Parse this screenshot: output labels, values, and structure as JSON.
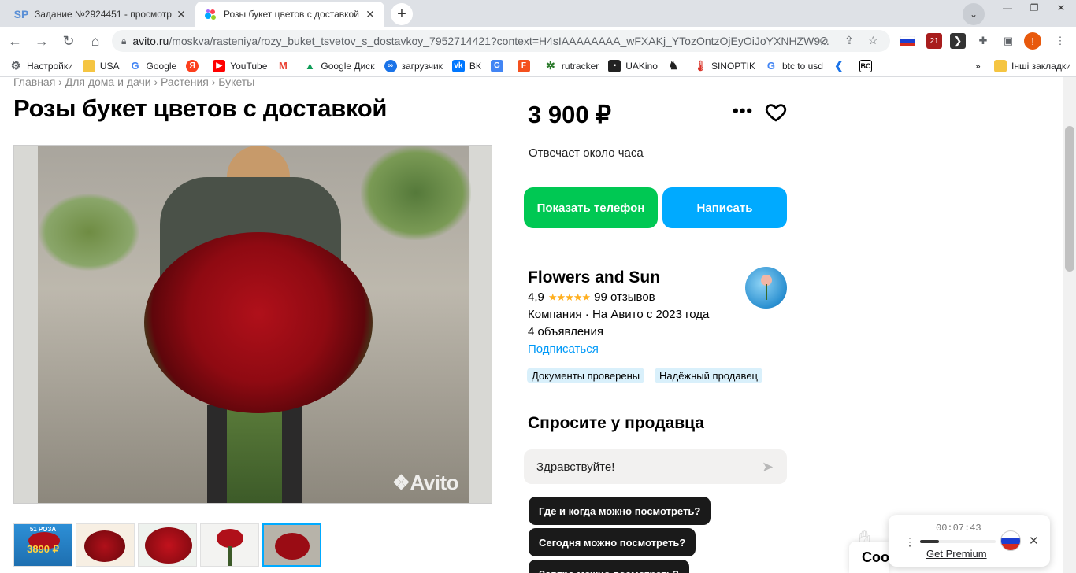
{
  "browser": {
    "tabs": [
      {
        "title": "Задание №2924451 - просмотр",
        "favicon": "SP",
        "active": false
      },
      {
        "title": "Розы букет цветов с доставкой",
        "favicon": "avito-dots",
        "active": true
      }
    ],
    "url_host": "avito.ru",
    "url_rest": "/moskva/rasteniya/rozy_buket_tsvetov_s_dostavkoy_7952714421?context=H4sIAAAAAAAA_wFXAKj_YTozOntzOjEyOiJoYXNHZW9...",
    "ext_badge": "21",
    "profile_letter": "!"
  },
  "bookmarks": [
    {
      "label": "Настройки",
      "icon": "gear-icon"
    },
    {
      "label": "USA",
      "icon": "folder-icon"
    },
    {
      "label": "Google",
      "icon": "google-icon"
    },
    {
      "label": "",
      "icon": "yandex-icon"
    },
    {
      "label": "YouTube",
      "icon": "youtube-icon"
    },
    {
      "label": "",
      "icon": "gmail-icon"
    },
    {
      "label": "Google Диск",
      "icon": "drive-icon"
    },
    {
      "label": "загрузчик",
      "icon": "infinity-icon"
    },
    {
      "label": "ВК",
      "icon": "vk-icon"
    },
    {
      "label": "",
      "icon": "translate-icon"
    },
    {
      "label": "",
      "icon": "f-icon"
    },
    {
      "label": "rutracker",
      "icon": "rutracker-icon"
    },
    {
      "label": "UAKino",
      "icon": "uakino-icon"
    },
    {
      "label": "",
      "icon": "horse-icon"
    },
    {
      "label": "SINOPTIK",
      "icon": "thermometer-icon"
    },
    {
      "label": "btc to usd",
      "icon": "google-icon"
    },
    {
      "label": "",
      "icon": "arrow-icon"
    },
    {
      "label": "",
      "icon": "bc-icon"
    }
  ],
  "bookmarks_more": "»",
  "bookmarks_other": "Інші закладки",
  "page": {
    "breadcrumb": "Главная › Для дома и дачи › Растения › Букеты",
    "title": "Розы букет цветов с доставкой",
    "photo_watermark": "Avito",
    "thumbs": [
      {
        "text_top": "51 РОЗА",
        "text_bottom": "3890 ₽"
      }
    ],
    "price": "3 900 ₽",
    "more_dots": "•••",
    "responds": "Отвечает около часа",
    "btn_phone": "Показать телефон",
    "btn_write": "Написать",
    "seller": {
      "name": "Flowers and Sun",
      "rating": "4,9",
      "stars": "★★★★★",
      "reviews": "99 отзывов",
      "company": "Компания · На Авито с 2023 года",
      "ads": "4 объявления",
      "subscribe": "Подписаться",
      "badges": [
        "Документы проверены",
        "Надёжный продавец"
      ]
    },
    "ask_title": "Спросите у продавца",
    "message_value": "Здравствуйте!",
    "quick_questions": [
      "Где и когда можно посмотреть?",
      "Сегодня можно посмотреть?",
      "Завтра можно посмотреть?"
    ],
    "chat_peek": "Соо"
  },
  "recorder": {
    "time": "00:07:43",
    "progress": 0.25,
    "premium": "Get Premium"
  },
  "colors": {
    "green": "#00c853",
    "blue": "#00aaff",
    "link": "#0099f7",
    "star": "#ffb021"
  }
}
